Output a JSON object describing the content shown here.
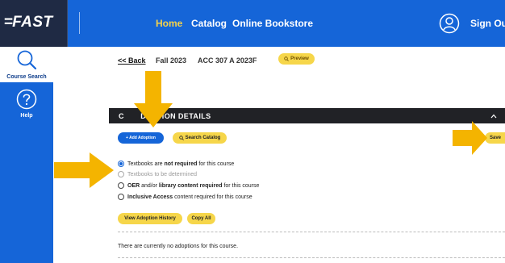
{
  "app": {
    "logo": "FAST",
    "nav": [
      "Home",
      "Catalog",
      "Online Bookstore"
    ],
    "sign_out": "Sign Out"
  },
  "sidebar": {
    "items": [
      {
        "label": "Course Search",
        "icon": "magnifier-icon",
        "active": true
      },
      {
        "label": "Help",
        "icon": "question-icon",
        "active": false
      }
    ]
  },
  "course_bar": {
    "back": "<< Back",
    "term": "Fall 2023",
    "course": "ACC 307 A 2023F",
    "preview": "Preview"
  },
  "section": {
    "title": "COURSE ADOPTION DETAILS",
    "title_visible": "C       DOPTION DETAILS"
  },
  "actions": {
    "add_adoption": "+ Add Adoption",
    "search_catalog": "Search Catalog",
    "save": "Save"
  },
  "options": [
    {
      "pre": "Textbooks are ",
      "bold": "not required",
      "post": " for this course",
      "selected": true,
      "disabled": false
    },
    {
      "pre": "Textbooks to be determined",
      "bold": "",
      "post": "",
      "selected": false,
      "disabled": true
    },
    {
      "pre": "",
      "bold": "OER",
      "post": " and/or ",
      "bold2": "library content required",
      "post2": " for this course",
      "selected": false,
      "disabled": false
    },
    {
      "pre": "",
      "bold": "Inclusive Access",
      "post": " content required for this course",
      "selected": false,
      "disabled": false
    }
  ],
  "history": {
    "view_history": "View Adoption History",
    "copy_all": "Copy All"
  },
  "status": {
    "no_adoptions": "There are currently no adoptions for this course."
  },
  "colors": {
    "primary_blue": "#1565d8",
    "dark_navy": "#1f2a44",
    "accent_yellow": "#f6d64a",
    "arrow_yellow": "#f4b400",
    "header_dark": "#212226"
  }
}
